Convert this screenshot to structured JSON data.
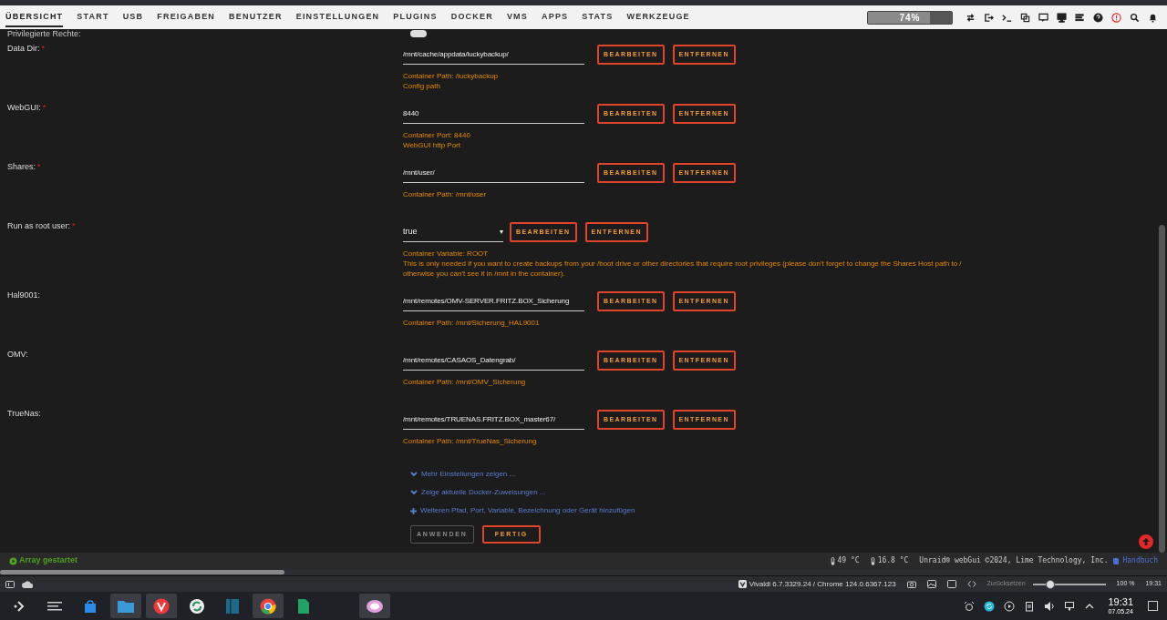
{
  "nav": {
    "tabs": [
      {
        "label": "ÜBERSICHT",
        "selected": true
      },
      {
        "label": "START",
        "selected": false
      },
      {
        "label": "USB",
        "selected": false
      },
      {
        "label": "FREIGABEN",
        "selected": false
      },
      {
        "label": "BENUTZER",
        "selected": false
      },
      {
        "label": "EINSTELLUNGEN",
        "selected": false
      },
      {
        "label": "PLUGINS",
        "selected": false
      },
      {
        "label": "DOCKER",
        "selected": false
      },
      {
        "label": "VMS",
        "selected": false
      },
      {
        "label": "APPS",
        "selected": false
      },
      {
        "label": "STATS",
        "selected": false
      },
      {
        "label": "WERKZEUGE",
        "selected": false
      }
    ],
    "usage": {
      "level": 0.74,
      "reading": "74%"
    }
  },
  "privileged": {
    "label": "Privilegierte Rechte:",
    "on": false
  },
  "rows": [
    {
      "label": "Data Dir:",
      "required_mark": "*",
      "kind": "text",
      "value": "/mnt/cache/appdata/luckybackup/",
      "buttons": [
        "BEARBEITEN",
        "ENTFERNEN"
      ],
      "help": [
        "Container Path: /luckybackup",
        "Config path"
      ]
    },
    {
      "label": "WebGUI:",
      "required_mark": "*",
      "kind": "text",
      "value": "8440",
      "buttons": [
        "BEARBEITEN",
        "ENTFERNEN"
      ],
      "help": [
        "Container Port: 8440",
        "WebGUI http Port"
      ]
    },
    {
      "label": "Shares:",
      "required_mark": "*",
      "kind": "text",
      "value": "/mnt/user/",
      "buttons": [
        "BEARBEITEN",
        "ENTFERNEN"
      ],
      "help": [
        "Container Path: /mnt/user"
      ]
    },
    {
      "label": "Run as root user:",
      "required_mark": "*",
      "kind": "select",
      "value": "true",
      "caret": "▾",
      "buttons": [
        "BEARBEITEN",
        "ENTFERNEN"
      ],
      "help": [
        "Container Variable: ROOT",
        "This is only needed if you want to create backups from your /boot drive or other directories that require root privileges (please don't forget to change the Shares Host path to /",
        "otherwise you can't see it in /mnt in the container)."
      ]
    },
    {
      "label": "Hal9001:",
      "kind": "text",
      "value": "/mnt/remotes/OMV-SERVER.FRITZ.BOX_Sicherung",
      "buttons": [
        "BEARBEITEN",
        "ENTFERNEN"
      ],
      "help": [
        "Container Path: /mnt/Sicherung_HAL9001"
      ]
    },
    {
      "label": "OMV:",
      "kind": "text",
      "value": "/mnt/remotes/CASAOS_Datengrab/",
      "buttons": [
        "BEARBEITEN",
        "ENTFERNEN"
      ],
      "help": [
        "Container Path: /mnt/OMV_Sicherung"
      ]
    },
    {
      "label": "TrueNas:",
      "kind": "text",
      "value": "/mnt/remotes/TRUENAS.FRITZ.BOX_master67/",
      "buttons": [
        "BEARBEITEN",
        "ENTFERNEN"
      ],
      "help": [
        "Container Path: /mnt/TrueNas_Sicherung"
      ]
    }
  ],
  "links": [
    {
      "kind": "expand",
      "label": "Mehr Einstellungen zeigen ..."
    },
    {
      "kind": "expand",
      "label": "Zeige aktuelle Docker-Zuweisungen ..."
    },
    {
      "kind": "add",
      "label": "Weiteren Pfad, Port, Variable, Bezeichnung oder Gerät hinzufügen"
    }
  ],
  "actions": [
    {
      "label": "ANWENDEN",
      "disabled": true
    },
    {
      "label": "FERTIG",
      "disabled": false
    }
  ],
  "status_bar": {
    "array": "Array gestartet",
    "temps": [
      "49 °C",
      "16.8 °C"
    ],
    "copyright": "Unraid® webGui ©2024, Lime Technology, Inc.",
    "manual": "Handbuch"
  },
  "browser_status": {
    "version": "Vivaldi 6.7.3329.24 / Chrome 124.0.6367.123",
    "reset": "Zurücksetzen",
    "zoom": {
      "level": 0.2
    },
    "zoom_reading": "100 %",
    "time": "19:31"
  },
  "taskbar": {
    "clock": "19:31",
    "date": "07.05.24"
  }
}
